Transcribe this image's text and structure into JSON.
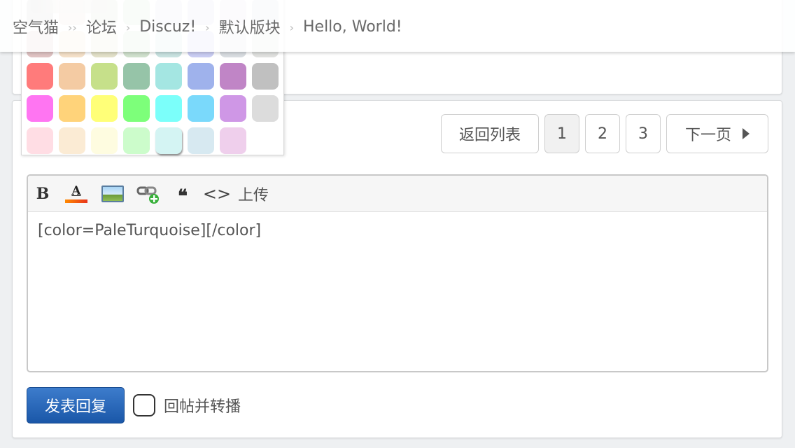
{
  "breadcrumb": {
    "items": [
      "空气猫",
      "论坛",
      "Discuz!",
      "默认版块"
    ],
    "current": "Hello, World!"
  },
  "palette": {
    "selected_color": "PaleTurquoise",
    "rows": [
      [
        "#c8c8c8",
        "#e8dcd2",
        "#d5dbc8",
        "#cfe2cf",
        "#dedde8",
        "#d7d7e8",
        "#e2d8e8",
        "#d7dfe0"
      ],
      [
        "#dfc2c2",
        "#f4e0c8",
        "#e2e0c8",
        "#cfe0cc",
        "#c8e2e0",
        "#c9ccf2",
        "#d8dce0",
        "#dfe0de"
      ],
      [
        "#ff7b7b",
        "#f4cba3",
        "#c6e08a",
        "#96c4a8",
        "#a4e6e2",
        "#9fb2ec",
        "#c085c6",
        "#c0c0c0"
      ],
      [
        "#ff75f2",
        "#ffd37a",
        "#ffff78",
        "#7dff7a",
        "#7bfffa",
        "#7ad9fb",
        "#cf97e6",
        "#dcdcdc"
      ],
      [
        "#ffdde4",
        "#fbebd4",
        "#fefce0",
        "#ccfccb",
        "#d4f4f3",
        "#d7e9f1",
        "#efcfec"
      ]
    ]
  },
  "pager": {
    "back_label": "返回列表",
    "pages": [
      "1",
      "2",
      "3"
    ],
    "current_page": "1",
    "next_label": "下一页"
  },
  "editor": {
    "toolbar": {
      "bold_label": "B",
      "color_label": "A",
      "quote_label": "❝",
      "code_label": "<>",
      "upload_label": "上传",
      "icons": [
        "bold-icon",
        "font-color-icon",
        "image-icon",
        "link-icon",
        "quote-icon",
        "code-icon"
      ]
    },
    "content": "[color=PaleTurquoise][/color]"
  },
  "reply": {
    "submit_label": "发表回复",
    "repost_label": "回帖并转播",
    "repost_checked": false,
    "accent_color": "#2462b5"
  }
}
